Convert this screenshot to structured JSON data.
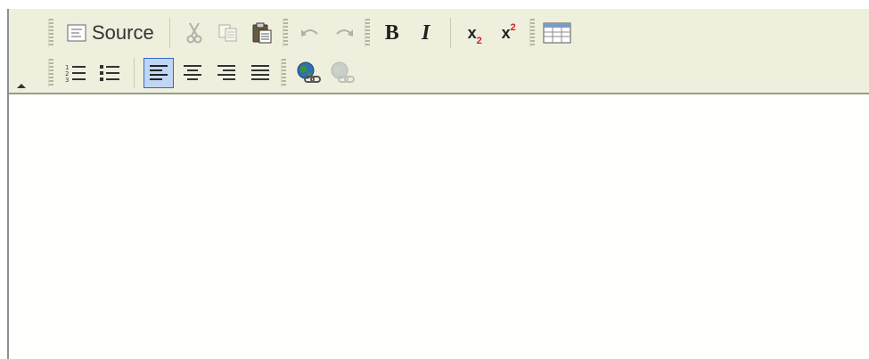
{
  "toolbar": {
    "row1": {
      "source_label": "Source",
      "bold_label": "B",
      "italic_label": "I",
      "subscript_base": "x",
      "subscript_script": "2",
      "superscript_base": "x",
      "superscript_script": "2"
    },
    "row2": {
      "active_alignment": "align-left"
    }
  },
  "editor": {
    "content": ""
  },
  "colors": {
    "toolbar_bg": "#efefde",
    "active_button_bg": "#c1d6f5",
    "active_button_border": "#316ac5"
  }
}
